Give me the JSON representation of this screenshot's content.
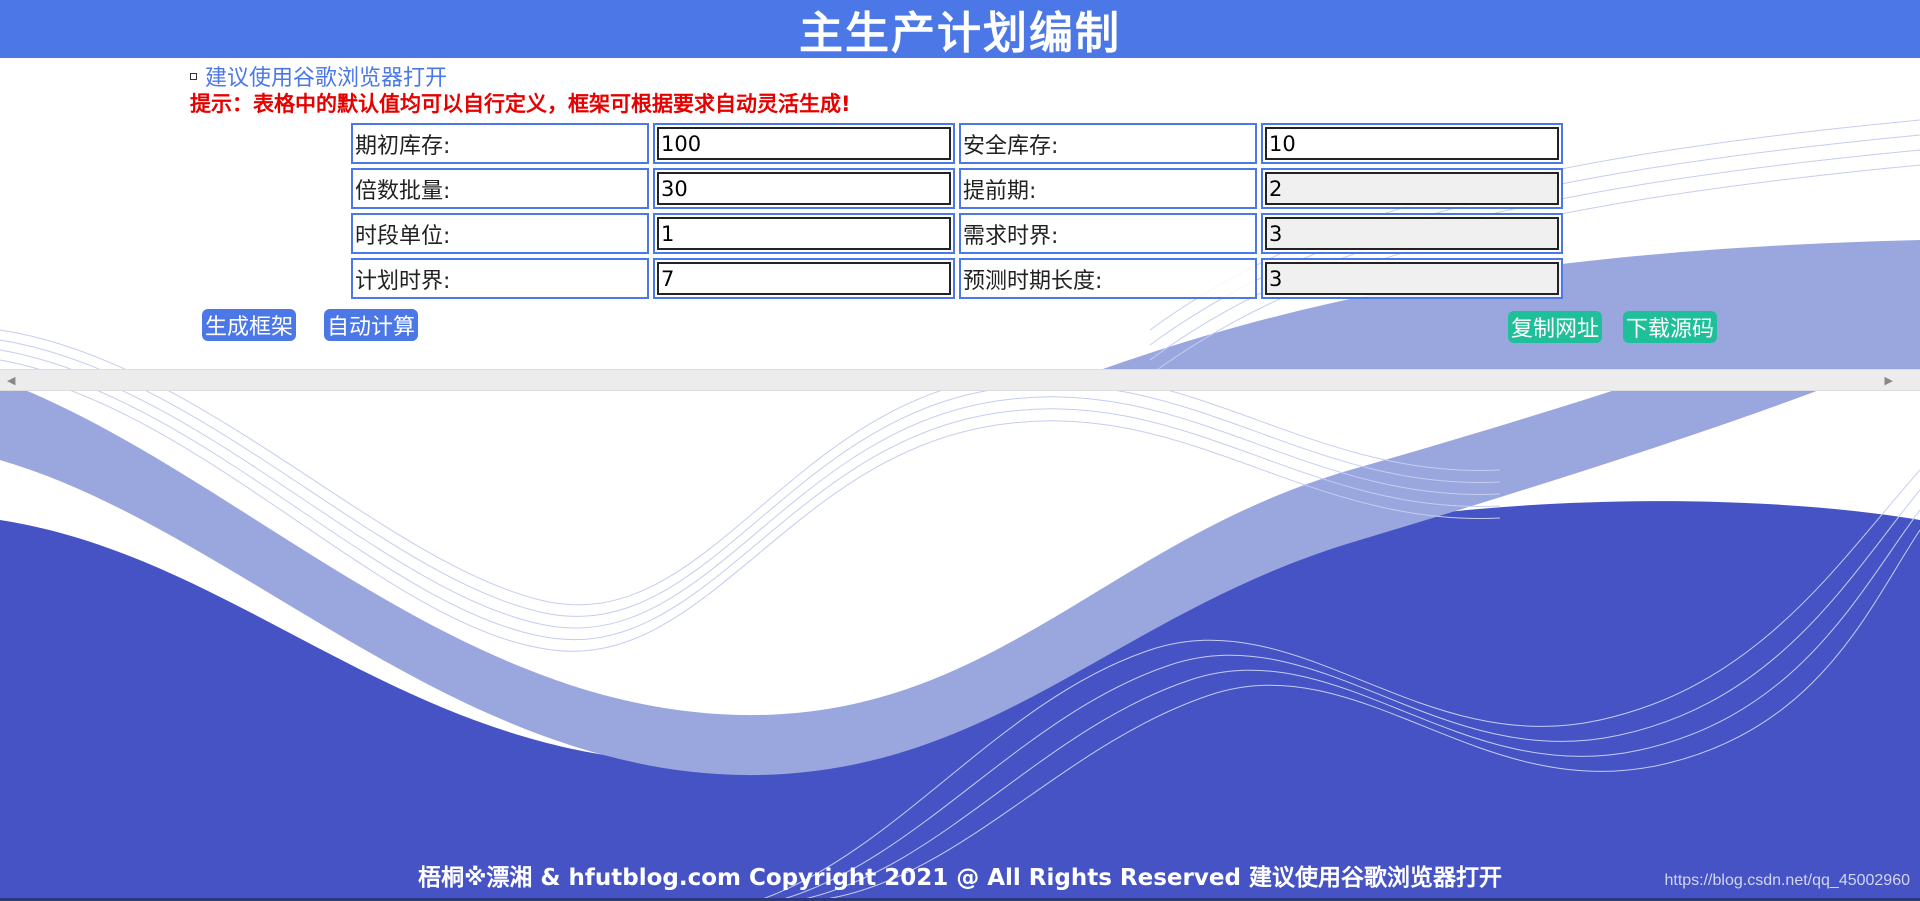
{
  "header": {
    "title": "主生产计划编制"
  },
  "notice": {
    "browser_link": "建议使用谷歌浏览器打开",
    "tip": "提示：表格中的默认值均可以自行定义，框架可根据要求自动灵活生成!"
  },
  "params": {
    "opening_inventory": {
      "label": "期初库存:",
      "value": "100"
    },
    "safety_stock": {
      "label": "安全库存:",
      "value": "10"
    },
    "lot_multiple": {
      "label": "倍数批量:",
      "value": "30"
    },
    "lead_time": {
      "label": "提前期:",
      "value": "2"
    },
    "period_unit": {
      "label": "时段单位:",
      "value": "1"
    },
    "demand_fence": {
      "label": "需求时界:",
      "value": "3"
    },
    "planning_fence": {
      "label": "计划时界:",
      "value": "7"
    },
    "forecast_length": {
      "label": "预测时期长度:",
      "value": "3"
    }
  },
  "buttons": {
    "generate": "生成框架",
    "calculate": "自动计算",
    "copy_url": "复制网址",
    "download": "下载源码"
  },
  "footer": {
    "copyright": "梧桐※漂湘 & hfutblog.com Copyright 2021 @ All Rights Reserved 建议使用谷歌浏览器打开",
    "watermark": "https://blog.csdn.net/qq_45002960"
  },
  "colors": {
    "header_bg": "#4b78e6",
    "tip_red": "#e60000",
    "button_blue": "#4b78e6",
    "button_teal": "#1fbf9a",
    "wave_dark": "#4653c4",
    "wave_light": "#9aa6de"
  }
}
